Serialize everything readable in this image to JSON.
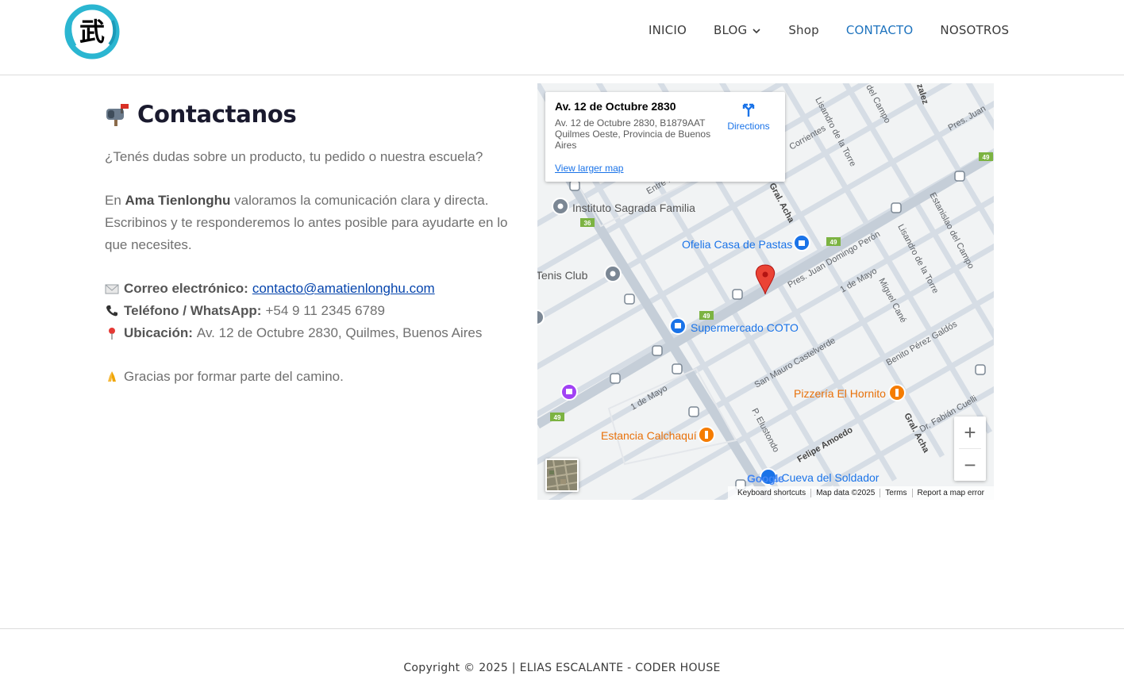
{
  "header": {
    "logo_glyph": "武",
    "nav": [
      {
        "label": "INICIO"
      },
      {
        "label": "BLOG"
      },
      {
        "label": "Shop"
      },
      {
        "label": "CONTACTO"
      },
      {
        "label": "NOSOTROS"
      }
    ],
    "active_index": 3,
    "active_color": "#1e73be"
  },
  "content": {
    "title_icon": "mailbox-icon",
    "title": "Contactanos",
    "intro": "¿Tenés dudas sobre un producto, tu pedido o nuestra escuela?",
    "p2_prefix": "En ",
    "p2_brand": "Ama Tienlonghu",
    "p2_rest": " valoramos la comunicación clara y directa. Escribinos y te responderemos lo antes posible para ayudarte en lo que necesites.",
    "email_label": "Correo electrónico:",
    "email_value": "contacto@amatienlonghu.com",
    "phone_label": "Teléfono / WhatsApp:",
    "phone_value": "+54 9 11 2345 6789",
    "location_label": "Ubicación:",
    "location_value": "Av. 12 de Octubre  2830, Quilmes, Buenos Aires",
    "thanks": "Gracias por formar parte del camino."
  },
  "map": {
    "place_title": "Av. 12 de Octubre 2830",
    "place_address": "Av. 12 de Octubre 2830, B1879AAT Quilmes Oeste, Provincia de Buenos Aires",
    "directions": "Directions",
    "larger_map": "View larger map",
    "pois": [
      "Instituto Sagrada Familia",
      "Ofelia Casa de Pastas",
      "Tenis Club",
      "Supermercado COTO",
      "Pizzería El Hornito",
      "Estancia Calchaquí",
      "La Cueva del Soldador"
    ],
    "streets": [
      "Pres. Juan Domingo Perón",
      "1 de Mayo",
      "Miguel Cané",
      "Lisandro de la Torre",
      "Estanislao del Campo",
      "San Mauro Castelverde",
      "Benito Pérez Galdós",
      "Gral. Acha",
      "Felipe Amoedo",
      "P. Elustondo",
      "Dr. Fabián Cuelli",
      "Entre Ríos",
      "Corrientes",
      "Pres. Juan",
      "Lisandro de la Torre",
      "del Campo",
      "zalez"
    ],
    "route_numbers": [
      "49",
      "36"
    ],
    "zoom_in": "+",
    "zoom_out": "−",
    "google": "Google",
    "attribution": [
      "Keyboard shortcuts",
      "Map data ©2025",
      "Terms",
      "Report a map error"
    ]
  },
  "footer": {
    "copyright": "Copyright © 2025 | ELIAS ESCALANTE - CODER HOUSE"
  }
}
